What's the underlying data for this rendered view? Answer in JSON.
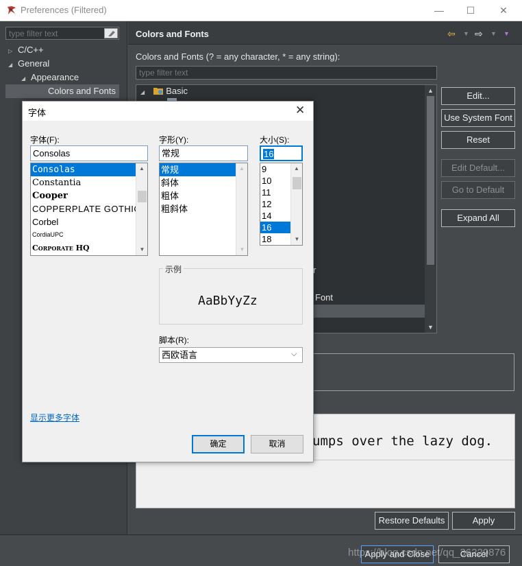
{
  "window": {
    "title": "Preferences (Filtered)",
    "minimize_glyph": "—",
    "maximize_glyph": "☐",
    "close_glyph": "✕"
  },
  "left_panel": {
    "filter_placeholder": "type filter text",
    "tree": [
      {
        "label": "C/C++",
        "expanded": false
      },
      {
        "label": "General",
        "expanded": true
      },
      {
        "label": "Appearance",
        "expanded": true
      },
      {
        "label": "Colors and Fonts",
        "selected": true
      }
    ]
  },
  "right_panel": {
    "title": "Colors and Fonts",
    "description": "Colors and Fonts (? = any character, * = any string):",
    "filter_placeholder": "type filter text",
    "tree_root": "Basic",
    "partial_item_1": "r",
    "partial_item_2": "Font",
    "buttons": {
      "edit": "Edit...",
      "use_system_font": "Use System Font",
      "reset": "Reset",
      "edit_default": "Edit Default...",
      "go_to_default": "Go to Default",
      "expand_all": "Expand All"
    },
    "preview_text": "umps over the lazy dog.",
    "restore_defaults": "Restore Defaults",
    "apply": "Apply"
  },
  "bottom_bar": {
    "apply_and_close": "Apply and Close",
    "cancel": "Cancel",
    "watermark": "https://blog.csdn.net/qq_36229876"
  },
  "font_dialog": {
    "title": "字体",
    "font_label": "字体(F):",
    "font_value": "Consolas",
    "font_list": [
      "Consolas",
      "Constantia",
      "Cooper",
      "COPPERPLATE GOTHIC",
      "Corbel",
      "CordiaUPC",
      "Corporate HQ"
    ],
    "style_label": "字形(Y):",
    "style_value": "常规",
    "style_list": [
      "常规",
      "斜体",
      "粗体",
      "粗斜体"
    ],
    "size_label": "大小(S):",
    "size_value": "16",
    "size_list": [
      "9",
      "10",
      "11",
      "12",
      "14",
      "16",
      "18"
    ],
    "sample_label": "示例",
    "sample_text": "AaBbYyZz",
    "script_label": "脚本(R):",
    "script_value": "西欧语言",
    "more_fonts_link": "显示更多字体",
    "ok": "确定",
    "cancel": "取消",
    "accent_color": "#0078d7"
  }
}
